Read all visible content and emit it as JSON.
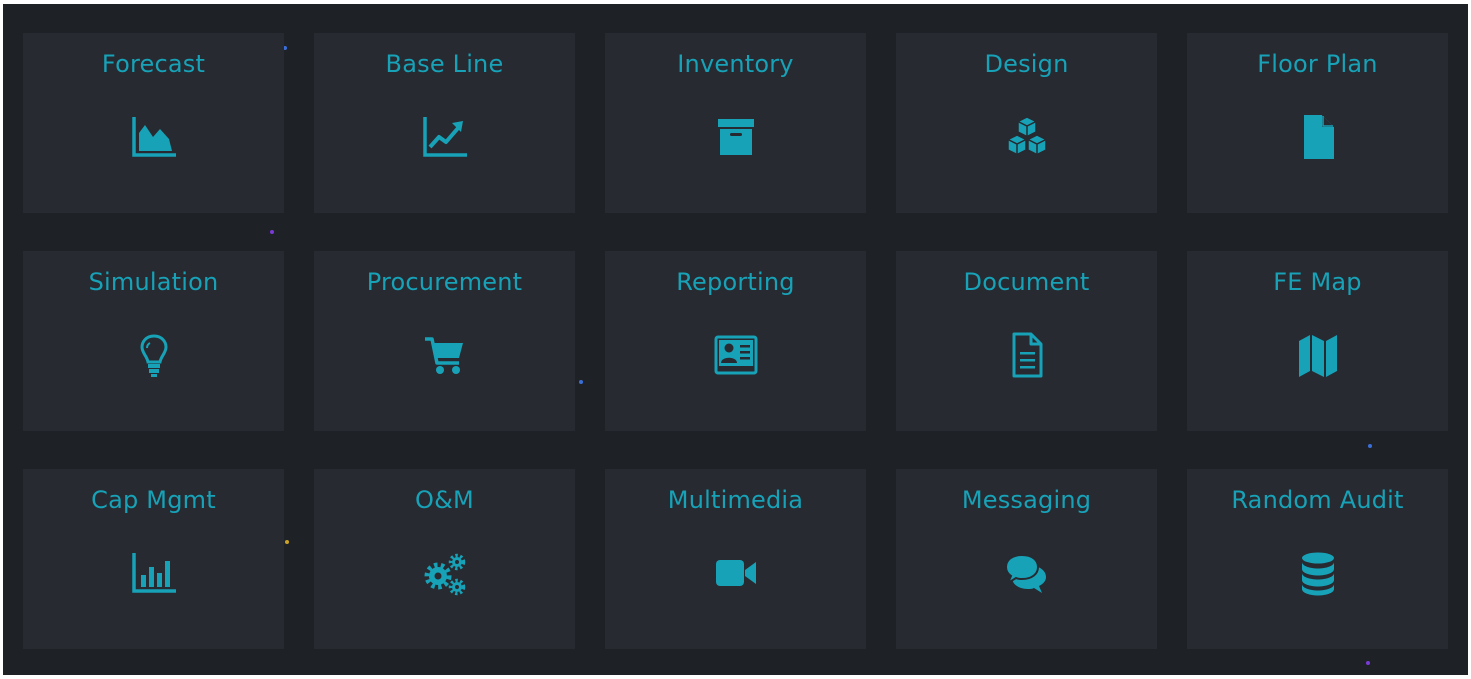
{
  "accent_color": "#17a2b8",
  "background_color": "#1e2126",
  "tile_color": "#272a30",
  "tiles": [
    {
      "label": "Forecast",
      "icon": "area-chart-icon"
    },
    {
      "label": "Base Line",
      "icon": "line-chart-icon"
    },
    {
      "label": "Inventory",
      "icon": "archive-box-icon"
    },
    {
      "label": "Design",
      "icon": "cubes-icon"
    },
    {
      "label": "Floor Plan",
      "icon": "file-icon"
    },
    {
      "label": "Simulation",
      "icon": "lightbulb-icon"
    },
    {
      "label": "Procurement",
      "icon": "shopping-cart-icon"
    },
    {
      "label": "Reporting",
      "icon": "id-card-icon"
    },
    {
      "label": "Document",
      "icon": "file-text-icon"
    },
    {
      "label": "FE Map",
      "icon": "map-icon"
    },
    {
      "label": "Cap Mgmt",
      "icon": "bar-chart-icon"
    },
    {
      "label": "O&M",
      "icon": "gears-icon"
    },
    {
      "label": "Multimedia",
      "icon": "video-camera-icon"
    },
    {
      "label": "Messaging",
      "icon": "chat-bubbles-icon"
    },
    {
      "label": "Random Audit",
      "icon": "database-icon"
    }
  ]
}
